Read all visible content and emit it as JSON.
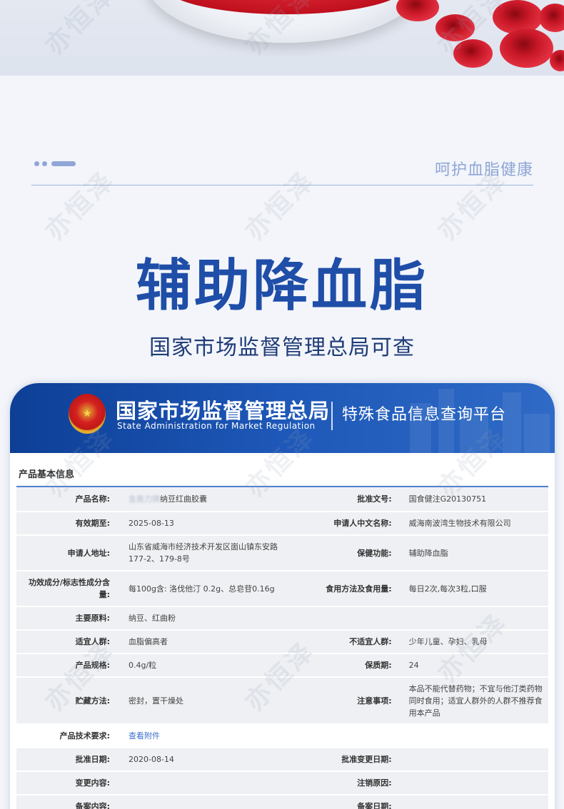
{
  "header": {
    "tagline": "呵护血脂健康",
    "main_title": "辅助降血脂",
    "sub_title": "国家市场监督管理总局可查"
  },
  "banner": {
    "title": "国家市场监督管理总局",
    "title_en": "State Administration  for  Market Regulation",
    "platform": "特殊食品信息查询平台"
  },
  "watermark": "亦恒泽",
  "section": {
    "title": "产品基本信息",
    "rows": [
      {
        "label1": "产品名称:",
        "value1_blur": "金奥力牌",
        "value1": "纳豆红曲胶囊",
        "label2": "批准文号:",
        "value2": "国食健注G20130751"
      },
      {
        "label1": "有效期至:",
        "value1": "2025-08-13",
        "label2": "申请人中文名称:",
        "value2": "威海南波湾生物技术有限公司"
      },
      {
        "label1": "申请人地址:",
        "value1": "山东省威海市经济技术开发区崮山镇东安路177-2、179-8号",
        "label2": "保健功能:",
        "value2": "辅助降血脂"
      },
      {
        "label1": "功效成分/标志性成分含量:",
        "value1": "每100g含: 洛伐他汀 0.2g、总皂苷0.16g",
        "label2": "食用方法及食用量:",
        "value2": "每日2次,每次3粒,口服"
      },
      {
        "label1": "主要原料:",
        "value1": "纳豆、红曲粉",
        "label2": "",
        "value2": ""
      },
      {
        "label1": "适宜人群:",
        "value1": "血脂偏高者",
        "label2": "不适宜人群:",
        "value2": "少年儿童、孕妇、乳母"
      },
      {
        "label1": "产品规格:",
        "value1": "0.4g/粒",
        "label2": "保质期:",
        "value2": "24"
      },
      {
        "label1": "贮藏方法:",
        "value1": "密封，置干燥处",
        "label2": "注意事项:",
        "value2": "本品不能代替药物；不宜与他汀类药物同时食用；适宜人群外的人群不推荐食用本产品"
      },
      {
        "label1": "产品技术要求:",
        "value1": "查看附件",
        "label2": "",
        "value2": ""
      },
      {
        "label1": "批准日期:",
        "value1": "2020-08-14",
        "label2": "批准变更日期:",
        "value2": ""
      },
      {
        "label1": "变更内容:",
        "value1": "",
        "label2": "注销原因:",
        "value2": ""
      },
      {
        "label1": "备案内容:",
        "value1": "",
        "label2": "备案日期:",
        "value2": ""
      }
    ]
  }
}
